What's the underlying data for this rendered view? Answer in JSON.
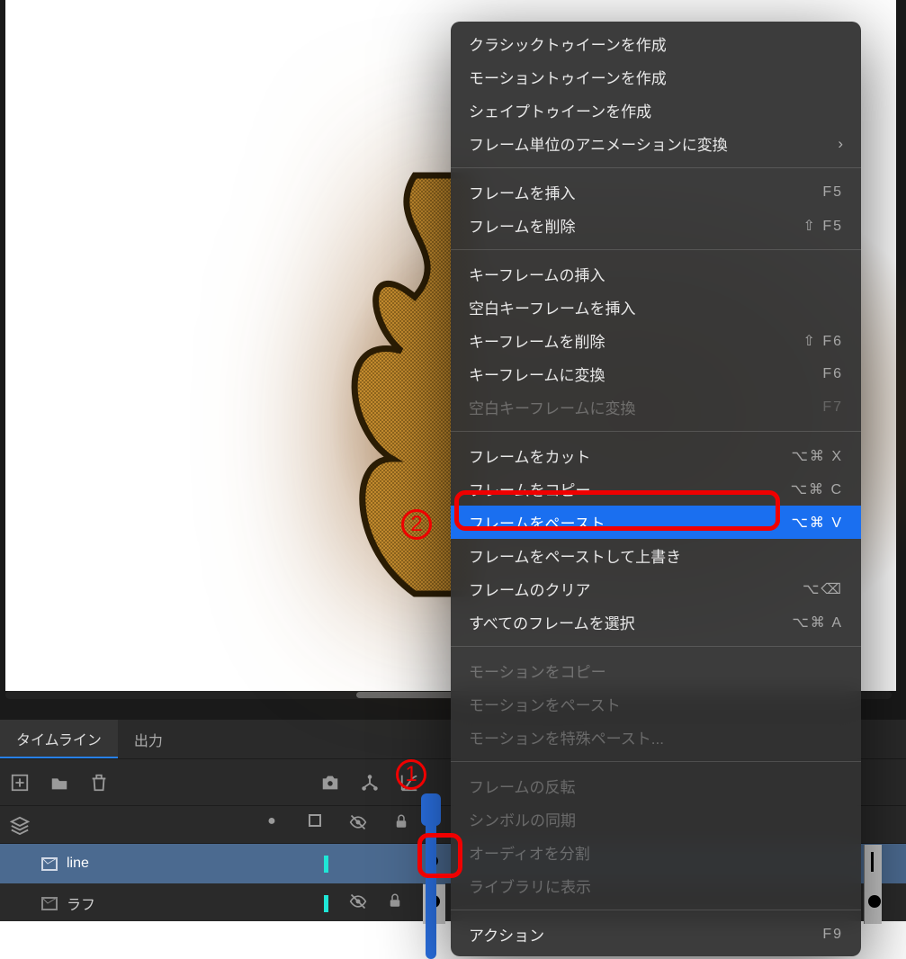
{
  "canvas": {
    "artwork_desc": "flame-shape-sketch"
  },
  "timeline": {
    "tabs": {
      "timeline": "タイムライン",
      "output": "出力"
    },
    "toolbar_icons": {
      "new_layer": "new-layer",
      "new_folder": "new-folder",
      "delete": "delete",
      "camera": "camera",
      "link": "link-layers",
      "graph": "ease-graph"
    },
    "header_icons": {
      "dot": "visibility-marker",
      "outline": "outline",
      "hide": "hide-eye",
      "lock": "lock"
    },
    "layers": [
      {
        "name": "line",
        "selected": true,
        "hidden": false,
        "locked": false
      },
      {
        "name": "ラフ",
        "selected": false,
        "hidden": true,
        "locked": true
      }
    ]
  },
  "context_menu": {
    "groups": [
      [
        {
          "label": "クラシックトゥイーンを作成",
          "short": "",
          "enabled": true
        },
        {
          "label": "モーショントゥイーンを作成",
          "short": "",
          "enabled": true
        },
        {
          "label": "シェイプトゥイーンを作成",
          "short": "",
          "enabled": true
        },
        {
          "label": "フレーム単位のアニメーションに変換",
          "short": "",
          "enabled": true,
          "submenu": true
        }
      ],
      [
        {
          "label": "フレームを挿入",
          "short": "F5",
          "enabled": true
        },
        {
          "label": "フレームを削除",
          "short": "⇧ F5",
          "enabled": true
        }
      ],
      [
        {
          "label": "キーフレームの挿入",
          "short": "",
          "enabled": true
        },
        {
          "label": "空白キーフレームを挿入",
          "short": "",
          "enabled": true
        },
        {
          "label": "キーフレームを削除",
          "short": "⇧ F6",
          "enabled": true
        },
        {
          "label": "キーフレームに変換",
          "short": "F6",
          "enabled": true
        },
        {
          "label": "空白キーフレームに変換",
          "short": "F7",
          "enabled": false
        }
      ],
      [
        {
          "label": "フレームをカット",
          "short": "⌥⌘ X",
          "enabled": true
        },
        {
          "label": "フレームをコピー",
          "short": "⌥⌘ C",
          "enabled": true
        },
        {
          "label": "フレームをペースト",
          "short": "⌥⌘ V",
          "enabled": true,
          "highlight": true
        },
        {
          "label": "フレームをペーストして上書き",
          "short": "",
          "enabled": true
        },
        {
          "label": "フレームのクリア",
          "short": "⌥⌫",
          "enabled": true
        },
        {
          "label": "すべてのフレームを選択",
          "short": "⌥⌘ A",
          "enabled": true
        }
      ],
      [
        {
          "label": "モーションをコピー",
          "short": "",
          "enabled": false
        },
        {
          "label": "モーションをペースト",
          "short": "",
          "enabled": false
        },
        {
          "label": "モーションを特殊ペースト...",
          "short": "",
          "enabled": false
        }
      ],
      [
        {
          "label": "フレームの反転",
          "short": "",
          "enabled": false
        },
        {
          "label": "シンボルの同期",
          "short": "",
          "enabled": false
        },
        {
          "label": "オーディオを分割",
          "short": "",
          "enabled": false
        },
        {
          "label": "ライブラリに表示",
          "short": "",
          "enabled": false
        }
      ],
      [
        {
          "label": "アクション",
          "short": "F9",
          "enabled": true
        }
      ]
    ]
  },
  "annotations": {
    "one": "1",
    "two": "2"
  }
}
